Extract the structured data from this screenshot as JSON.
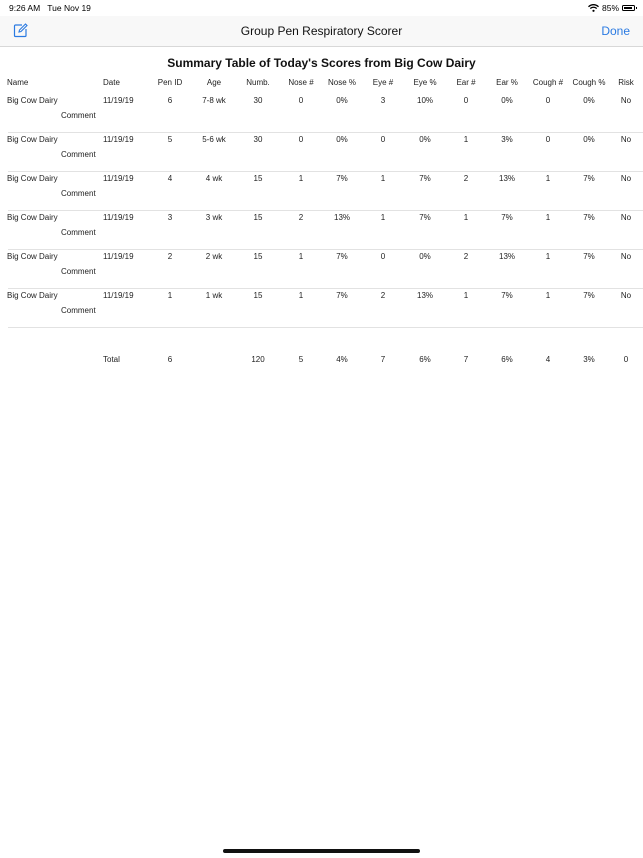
{
  "status": {
    "time": "9:26 AM",
    "date": "Tue Nov 19",
    "battery": "85%",
    "battery_level": 0.85
  },
  "nav": {
    "title": "Group Pen Respiratory Scorer",
    "done_label": "Done",
    "left_icon": "compose-icon"
  },
  "report": {
    "title": "Summary Table of Today's Scores from Big Cow Dairy",
    "headers": [
      "Name",
      "Date",
      "Pen ID",
      "Age",
      "Numb.",
      "Nose #",
      "Nose %",
      "Eye #",
      "Eye %",
      "Ear #",
      "Ear %",
      "Cough #",
      "Cough %",
      "Risk"
    ],
    "comment_label": "Comment",
    "rows": [
      [
        "Big Cow Dairy",
        "11/19/19",
        "6",
        "7-8 wk",
        "30",
        "0",
        "0%",
        "3",
        "10%",
        "0",
        "0%",
        "0",
        "0%",
        "No"
      ],
      [
        "Big Cow Dairy",
        "11/19/19",
        "5",
        "5-6 wk",
        "30",
        "0",
        "0%",
        "0",
        "0%",
        "1",
        "3%",
        "0",
        "0%",
        "No"
      ],
      [
        "Big Cow Dairy",
        "11/19/19",
        "4",
        "4 wk",
        "15",
        "1",
        "7%",
        "1",
        "7%",
        "2",
        "13%",
        "1",
        "7%",
        "No"
      ],
      [
        "Big Cow Dairy",
        "11/19/19",
        "3",
        "3 wk",
        "15",
        "2",
        "13%",
        "1",
        "7%",
        "1",
        "7%",
        "1",
        "7%",
        "No"
      ],
      [
        "Big Cow Dairy",
        "11/19/19",
        "2",
        "2 wk",
        "15",
        "1",
        "7%",
        "0",
        "0%",
        "2",
        "13%",
        "1",
        "7%",
        "No"
      ],
      [
        "Big Cow Dairy",
        "11/19/19",
        "1",
        "1 wk",
        "15",
        "1",
        "7%",
        "2",
        "13%",
        "1",
        "7%",
        "1",
        "7%",
        "No"
      ]
    ],
    "total": [
      "",
      "Total",
      "6",
      "",
      "120",
      "5",
      "4%",
      "7",
      "6%",
      "7",
      "6%",
      "4",
      "3%",
      "0"
    ]
  }
}
